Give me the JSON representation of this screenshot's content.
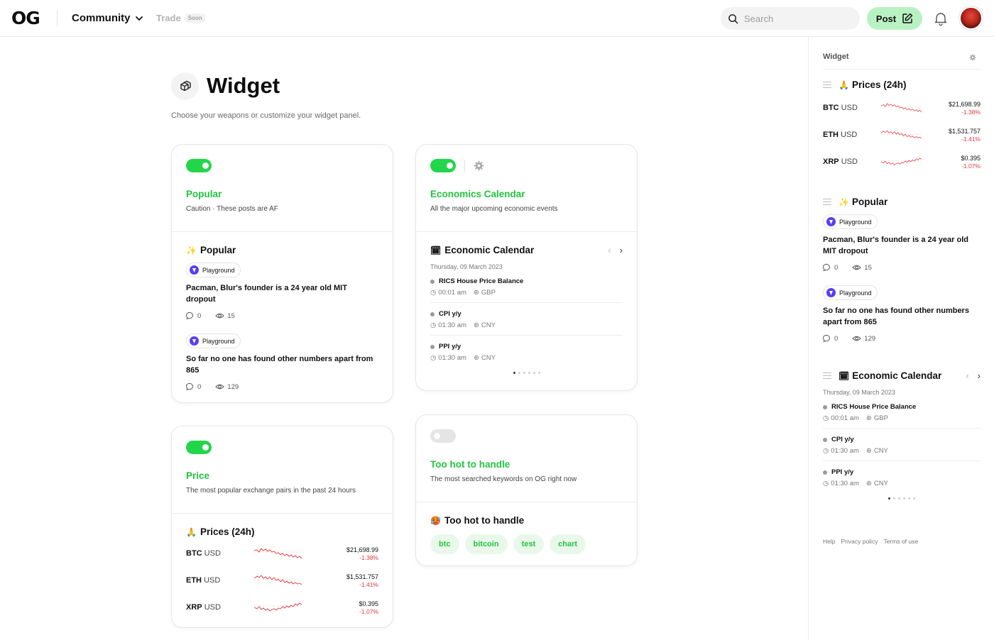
{
  "topbar": {
    "logo": "OG",
    "community": "Community",
    "trade": "Trade",
    "trade_badge": "Soon",
    "search_placeholder": "Search",
    "post_label": "Post"
  },
  "page": {
    "title": "Widget",
    "subtitle": "Choose your weapons or customize your widget panel."
  },
  "cards": {
    "popular": {
      "name": "Popular",
      "desc": "Caution · These posts are AF",
      "enabled": true
    },
    "economics": {
      "name": "Economics Calendar",
      "desc": "All the major upcoming economic events",
      "enabled": true
    },
    "price": {
      "name": "Price",
      "desc": "The most popular exchange pairs in the past 24 hours",
      "enabled": true
    },
    "hot": {
      "name": "Too hot to handle",
      "desc": "The most searched keywords on OG right now",
      "enabled": false
    }
  },
  "popular_widget": {
    "title": "Popular",
    "emoji": "✨",
    "posts": [
      {
        "community": "Playground",
        "text": "Pacman, Blur's founder is a 24 year old MIT dropout",
        "comments": "0",
        "views": "15"
      },
      {
        "community": "Playground",
        "text": "So far no one has found other numbers apart from 865",
        "comments": "0",
        "views": "129"
      }
    ]
  },
  "calendar_widget": {
    "title": "Economic Calendar",
    "emoji": "🗓",
    "date": "Thursday, 09 March 2023",
    "events": [
      {
        "name": "RICS House Price Balance",
        "time": "00:01 am",
        "currency": "GBP"
      },
      {
        "name": "CPI y/y",
        "time": "01:30 am",
        "currency": "CNY"
      },
      {
        "name": "PPI y/y",
        "time": "01:30 am",
        "currency": "CNY"
      }
    ],
    "page_index": 1,
    "page_count": 6
  },
  "prices_widget": {
    "title": "Prices (24h)",
    "emoji": "🙏",
    "pairs": [
      {
        "base": "BTC",
        "quote": "USD",
        "value": "$21,698.99",
        "change": "-1.38%"
      },
      {
        "base": "ETH",
        "quote": "USD",
        "value": "$1,531.757",
        "change": "-1.41%"
      },
      {
        "base": "XRP",
        "quote": "USD",
        "value": "$0.395",
        "change": "-1.07%"
      }
    ]
  },
  "hot_widget": {
    "title": "Too hot to handle",
    "emoji": "🥵",
    "tags": [
      "btc",
      "bitcoin",
      "test",
      "chart"
    ]
  },
  "sidebar": {
    "header": "Widget",
    "footer": [
      "Help",
      "Privacy policy",
      "Terms of use"
    ]
  },
  "colors": {
    "accent_green": "#22c43e",
    "toggle_on": "#22d64a",
    "post_button": "#b9f2c2",
    "negative_red": "#e0393d"
  }
}
